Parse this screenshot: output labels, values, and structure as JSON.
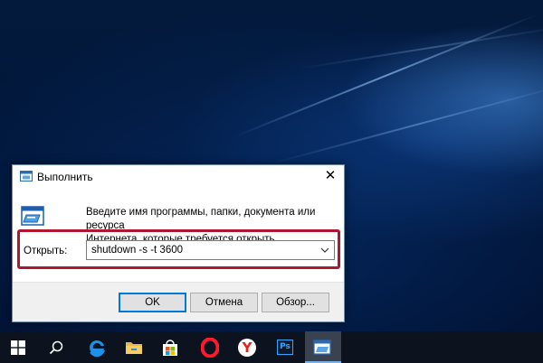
{
  "dialog": {
    "title": "Выполнить",
    "description_line1": "Введите имя программы, папки, документа или ресурса",
    "description_line2": "Интернета, которые требуется открыть.",
    "open_label": "Открыть:",
    "command_value": "shutdown -s -t 3600",
    "ok_label": "OK",
    "cancel_label": "Отмена",
    "browse_label": "Обзор...",
    "highlight_color": "#b0172c"
  },
  "taskbar": {
    "items": [
      {
        "name": "start",
        "icon": "windows-logo-icon"
      },
      {
        "name": "search",
        "icon": "search-icon"
      },
      {
        "name": "edge",
        "icon": "edge-icon"
      },
      {
        "name": "file-explorer",
        "icon": "folder-icon"
      },
      {
        "name": "store",
        "icon": "store-icon"
      },
      {
        "name": "opera",
        "icon": "opera-icon"
      },
      {
        "name": "yandex",
        "icon": "yandex-icon",
        "glyph": "Y"
      },
      {
        "name": "photoshop",
        "icon": "photoshop-icon",
        "glyph": "Ps"
      },
      {
        "name": "run",
        "icon": "run-icon",
        "active": true
      }
    ]
  }
}
